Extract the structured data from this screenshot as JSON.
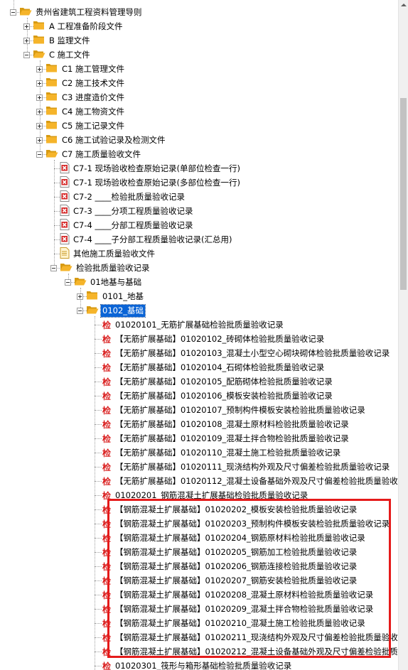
{
  "tree": {
    "root": {
      "label": "贵州省建筑工程资料管理导则"
    },
    "sections": [
      {
        "label": "A 工程准备阶段文件",
        "expanded": false
      },
      {
        "label": "B 监理文件",
        "expanded": false
      },
      {
        "label": "C 施工文件",
        "expanded": true
      }
    ],
    "c_children": [
      {
        "label": "C1 施工管理文件",
        "expanded": false
      },
      {
        "label": "C2 施工技术文件",
        "expanded": false
      },
      {
        "label": "C3 进度造价文件",
        "expanded": false
      },
      {
        "label": "C4 施工物资文件",
        "expanded": false
      },
      {
        "label": "C5 施工记录文件",
        "expanded": false
      },
      {
        "label": "C6 施工试验记录及检测文件",
        "expanded": false
      },
      {
        "label": "C7 施工质量验收文件",
        "expanded": true
      }
    ],
    "c7_children": [
      {
        "label": "C7-1 现场验收检查原始记录(单部位检查一行)",
        "icon": "x-doc-icon"
      },
      {
        "label": "C7-1 现场验收检查原始记录(多部位检查一行)",
        "icon": "x-doc-icon"
      },
      {
        "label": "C7-2 ____检验批质量验收记录",
        "icon": "x-doc-icon"
      },
      {
        "label": "C7-3 ____分项工程质量验收记录",
        "icon": "x-doc-icon"
      },
      {
        "label": "C7-4 ____分部工程质量验收记录",
        "icon": "x-doc-icon"
      },
      {
        "label": "C7-4 ____子分部工程质量验收记录(汇总用)",
        "icon": "x-doc-icon"
      },
      {
        "label": "其他施工质量验收文件",
        "icon": "doc-icon"
      },
      {
        "label": "检验批质量验收记录",
        "icon": "folder-icon",
        "expanded": true
      }
    ],
    "jyp_children": [
      {
        "label": "01地基与基础",
        "expanded": true
      }
    ],
    "dj_children": [
      {
        "label": "0101_地基",
        "expanded": false
      },
      {
        "label": "0102_基础",
        "expanded": true,
        "selected": true
      }
    ],
    "jichu_icon_char": "检",
    "jichu_items": [
      "01020101_无筋扩展基础检验批质量验收记录",
      "【无筋扩展基础】01020102_砖砌体检验批质量验收记录",
      "【无筋扩展基础】01020103_混凝土小型空心砌块砌体检验批质量验收记录",
      "【无筋扩展基础】01020104_石砌体检验批质量验收记录",
      "【无筋扩展基础】01020105_配筋砌体检验批质量验收记录",
      "【无筋扩展基础】01020106_模板安装检验批质量验收记录",
      "【无筋扩展基础】01020107_预制构件模板安装检验批质量验收记录",
      "【无筋扩展基础】01020108_混凝土原材料检验批质量验收记录",
      "【无筋扩展基础】01020109_混凝土拌合物检验批质量验收记录",
      "【无筋扩展基础】01020110_混凝土施工检验批质量验收记录",
      "【无筋扩展基础】01020111_现浇结构外观及尺寸偏差检验批质量验收记录",
      "【无筋扩展基础】01020112_混凝土设备基础外观及尺寸偏差检验批质量验收",
      "01020201_钢筋混凝土扩展基础检验批质量验收记录",
      "【钢筋混凝土扩展基础】01020202_模板安装检验批质量验收记录",
      "【钢筋混凝土扩展基础】01020203_预制构件模板安装检验批质量验收记录",
      "【钢筋混凝土扩展基础】01020204_钢筋原材料检验批质量验收记录",
      "【钢筋混凝土扩展基础】01020205_钢筋加工检验批质量验收记录",
      "【钢筋混凝土扩展基础】01020206_钢筋连接检验批质量验收记录",
      "【钢筋混凝土扩展基础】01020207_钢筋安装检验批质量验收记录",
      "【钢筋混凝土扩展基础】01020208_混凝土原材料检验批质量验收记录",
      "【钢筋混凝土扩展基础】01020209_混凝土拌合物检验批质量验收记录",
      "【钢筋混凝土扩展基础】01020210_混凝土施工检验批质量验收记录",
      "【钢筋混凝土扩展基础】01020211_现浇结构外观及尺寸偏差检验批质量验收",
      "【钢筋混凝土扩展基础】01020212_混凝土设备基础外观及尺寸偏差检验批质",
      "01020301_筏形与箱形基础检验批质量验收记录"
    ]
  },
  "colors": {
    "selection": "#0a64d6",
    "highlight_border": "#e51b1b",
    "jian_icon": "#d91e1e",
    "folder": "#f5b42a"
  }
}
